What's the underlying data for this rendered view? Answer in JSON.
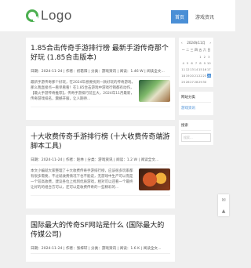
{
  "brand": {
    "logo_text": "Logo",
    "accent": "#4a8fd6"
  },
  "nav": [
    "首页",
    "游戏资讯",
    "热"
  ],
  "posts": [
    {
      "title": "1.85合击传奇手游排行榜 最新手游传奇那个好玩 (1.85合击版本)",
      "meta": "日期：2024-11-24 | 作者：初箬阳 | 分类：游戏资讯 | 阅读：1.46 W | 阅读全文...",
      "excerpt": "最新手游传奇那个好玩，在2024年想要找到一款好玩的传奇游戏，那么我直接点一看单看看！在1.85合击游戏中游戏行销都有动作，【最火手游传奇推荐】，传奇手游排行前五大，2024年11月最新，传奇游戏排名，震撼开服，让人期待..."
    },
    {
      "title": "十大收费传奇手游排行榜 (十大收费传奇端游脚本工具)",
      "meta": "日期：2024-11-24 | 作者：赵林 | 分类：游戏资讯 | 阅读：1.2 W | 阅读全文...",
      "excerpt": "本文小编就大家整理了十大收费传奇手游排行榜，应该很多玩家都有很多需要，不过就收费情况下也不能说，无游戏中生产可以而是一个较高收费，建议各位上找到优质游戏，相对可以还看一个最终让好的的组合方可以，还可以是收费传奇的一些精彩的..."
    },
    {
      "title": "国际最大的传奇SF网站是什么 (国际最大的传媒公司)",
      "meta": "日期：2024-11-24 | 作者：张梓轩 | 分类：游戏资讯 | 阅读：1.6 K | 阅读全文..."
    }
  ],
  "calendar": {
    "month_label": "2024年11月",
    "prev": "‹",
    "next": "›",
    "weekdays": [
      "一",
      "二",
      "三",
      "四",
      "五",
      "六",
      "日"
    ],
    "days": [
      "",
      "",
      "",
      "",
      "1",
      "2",
      "3",
      "4",
      "5",
      "6",
      "7",
      "8",
      "9",
      "10",
      "11",
      "12",
      "13",
      "14",
      "15",
      "16",
      "17",
      "18",
      "19",
      "20",
      "21",
      "22",
      "23",
      "24",
      "25",
      "26",
      "27",
      "28",
      "29",
      "30",
      ""
    ],
    "today": "24"
  },
  "categories": {
    "title": "网站分类",
    "items": [
      "游戏资讯"
    ]
  },
  "search": {
    "title": "搜索",
    "placeholder": "搜索..."
  }
}
